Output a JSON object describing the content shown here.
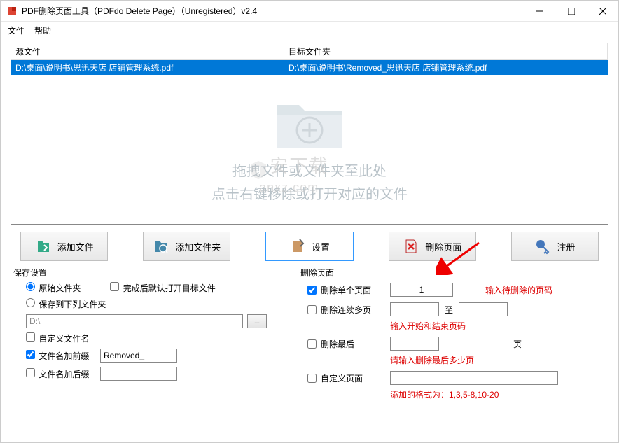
{
  "window": {
    "title": "PDF删除页面工具（PDFdo Delete Page）（Unregistered）v2.4"
  },
  "menu": {
    "file": "文件",
    "help": "帮助"
  },
  "file_list": {
    "col_source": "源文件",
    "col_target": "目标文件夹",
    "rows": [
      {
        "source": "D:\\桌面\\说明书\\思迅天店 店铺管理系统.pdf",
        "target": "D:\\桌面\\说明书\\Removed_思迅天店 店铺管理系统.pdf"
      }
    ]
  },
  "drop_area": {
    "line1": "拖拽文件或文件夹至此处",
    "line2": "点击右键移除或打开对应的文件"
  },
  "watermark": {
    "name": "安下载",
    "domain": "anxz.com"
  },
  "toolbar": {
    "add_file": "添加文件",
    "add_folder": "添加文件夹",
    "settings": "设置",
    "delete_page": "删除页面",
    "register": "注册"
  },
  "save_settings": {
    "title": "保存设置",
    "radio_original": "原始文件夹",
    "radio_custom": "保存到下列文件夹",
    "check_open_after": "完成后默认打开目标文件",
    "path_value": "D:\\",
    "browse": "...",
    "check_custom_name": "自定义文件名",
    "check_prefix": "文件名加前缀",
    "check_suffix": "文件名加后缀",
    "prefix_value": "Removed_",
    "suffix_value": ""
  },
  "delete_settings": {
    "title": "删除页面",
    "check_single": "删除单个页面",
    "single_value": "1",
    "hint_single": "输入待删除的页码",
    "check_range": "删除连续多页",
    "range_from": "",
    "range_to_label": "至",
    "range_to": "",
    "hint_range": "输入开始和结束页码",
    "check_last": "删除最后",
    "last_value": "",
    "last_unit": "页",
    "hint_last": "请输入删除最后多少页",
    "check_custom": "自定义页面",
    "custom_value": "",
    "hint_custom": "添加的格式为：1,3,5-8,10-20"
  }
}
